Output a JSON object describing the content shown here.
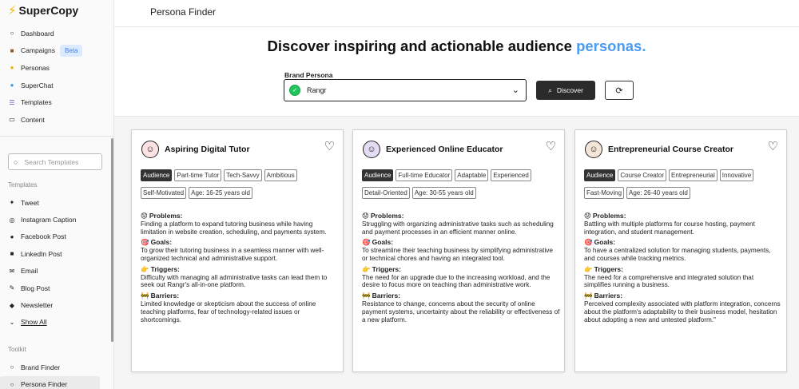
{
  "app": {
    "name": "SuperCopy"
  },
  "nav": [
    {
      "label": "Dashboard",
      "icon": "circle-icon"
    },
    {
      "label": "Campaigns",
      "icon": "book-icon",
      "badge": "Beta"
    },
    {
      "label": "Personas",
      "icon": "smile-icon"
    },
    {
      "label": "SuperChat",
      "icon": "chat-icon"
    },
    {
      "label": "Templates",
      "icon": "list-icon"
    },
    {
      "label": "Content",
      "icon": "folder-icon"
    }
  ],
  "search": {
    "placeholder": "Search Templates"
  },
  "templates_label": "Templates",
  "templates": [
    {
      "label": "Tweet",
      "icon": "twitter-icon"
    },
    {
      "label": "Instagram Caption",
      "icon": "instagram-icon"
    },
    {
      "label": "Facebook Post",
      "icon": "facebook-icon"
    },
    {
      "label": "LinkedIn Post",
      "icon": "linkedin-icon"
    },
    {
      "label": "Email",
      "icon": "mail-icon"
    },
    {
      "label": "Blog Post",
      "icon": "pen-icon"
    },
    {
      "label": "Newsletter",
      "icon": "megaphone-icon"
    },
    {
      "label": "Show All",
      "icon": "chevron-down-icon"
    }
  ],
  "toolkit_label": "Toolkit",
  "toolkit": [
    {
      "label": "Brand Finder",
      "icon": "search-icon"
    },
    {
      "label": "Persona Finder",
      "icon": "search-icon"
    }
  ],
  "header": {
    "title": "Persona Finder"
  },
  "headline": {
    "main": "Discover inspiring and actionable audience ",
    "accent": "personas."
  },
  "brand_persona": {
    "label": "Brand Persona",
    "selected": "Rangr"
  },
  "discover_label": "Discover",
  "colors": {
    "accent": "#4a9cf2",
    "button_dark": "#2b2b2b",
    "badge_bg": "#dbeafe"
  },
  "cards": [
    {
      "name": "Aspiring Digital Tutor",
      "tags": [
        "Audience",
        "Part-time Tutor",
        "Tech-Savvy",
        "Ambitious",
        "Self-Motivated",
        "Age: 16-25 years old"
      ],
      "problems_title": "Problems:",
      "problems": "Finding a platform to expand tutoring business while having limitation in website creation, scheduling, and payments system.",
      "goals_title": "Goals:",
      "goals": "To grow their tutoring business in a seamless manner with well-organized technical and administrative support.",
      "triggers_title": "Triggers:",
      "triggers": "Difficulty with managing all administrative tasks can lead them to seek out Rangr's all-in-one platform.",
      "barriers_title": "Barriers:",
      "barriers": "Limited knowledge or skepticism about the success of online teaching platforms, fear of technology-related issues or shortcomings."
    },
    {
      "name": "Experienced Online Educator",
      "tags": [
        "Audience",
        "Full-time Educator",
        "Adaptable",
        "Experienced",
        "Detail-Oriented",
        "Age: 30-55 years old"
      ],
      "problems_title": "Problems:",
      "problems": "Struggling with organizing administrative tasks such as scheduling and payment processes in an efficient manner online.",
      "goals_title": "Goals:",
      "goals": "To streamline their teaching business by simplifying administrative or technical chores and having an integrated tool.",
      "triggers_title": "Triggers:",
      "triggers": "The need for an upgrade due to the increasing workload, and the desire to focus more on teaching than administrative work.",
      "barriers_title": "Barriers:",
      "barriers": "Resistance to change, concerns about the security of online payment systems, uncertainty about the reliability or effectiveness of a new platform."
    },
    {
      "name": "Entrepreneurial Course Creator",
      "tags": [
        "Audience",
        "Course Creator",
        "Entrepreneurial",
        "Innovative",
        "Fast-Moving",
        "Age: 26-40 years old"
      ],
      "problems_title": "Problems:",
      "problems": "Battling with multiple platforms for course hosting, payment integration, and student management.",
      "goals_title": "Goals:",
      "goals": "To have a centralized solution for managing students, payments, and courses while tracking metrics.",
      "triggers_title": "Triggers:",
      "triggers": "The need for a comprehensive and integrated solution that simplifies running a business.",
      "barriers_title": "Barriers:",
      "barriers": "Perceived complexity associated with platform integration, concerns about the platform's adaptability to their business model, hesitation about adopting a new and untested platform.\""
    }
  ]
}
